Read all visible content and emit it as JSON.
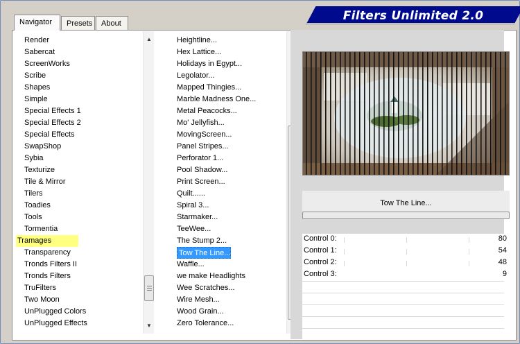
{
  "tabs": [
    {
      "label": "Navigator",
      "active": true
    },
    {
      "label": "Presets",
      "active": false
    },
    {
      "label": "About",
      "active": false
    }
  ],
  "banner": {
    "title": "Filters Unlimited 2.0",
    "color": "#000a8c"
  },
  "categories": {
    "items": [
      "Render",
      "Sabercat",
      "ScreenWorks",
      "Scribe",
      "Shapes",
      "Simple",
      "Special Effects 1",
      "Special Effects 2",
      "Special Effects",
      "SwapShop",
      "Sybia",
      "Texturize",
      "Tile & Mirror",
      "Tilers",
      "Toadies",
      "Tools",
      "Tormentia",
      "Tramages",
      "Transparency",
      "Tronds Filters II",
      "Tronds Filters",
      "TruFilters",
      "Two Moon",
      "UnPlugged Colors",
      "UnPlugged Effects"
    ],
    "marked_item": "Tramages"
  },
  "filters": {
    "items": [
      "Heightline...",
      "Hex Lattice...",
      "Holidays in Egypt...",
      "Legolator...",
      "Mapped Thingies...",
      "Marble Madness One...",
      "Metal Peacocks...",
      "Mo' Jellyfish...",
      "MovingScreen...",
      "Panel Stripes...",
      "Perforator 1...",
      "Pool Shadow...",
      "Print Screen...",
      "Quilt......",
      "Spiral 3...",
      "Starmaker...",
      "TeeWee...",
      "The Stump 2...",
      "Tow The Line...",
      "Waffle...",
      "we make Headlights",
      "Wee Scratches...",
      "Wire Mesh...",
      "Wood Grain...",
      "Zero Tolerance..."
    ],
    "selected_item": "Tow The Line..."
  },
  "icons": {
    "scroll_up": "scroll-up-arrow-icon",
    "scroll_down": "scroll-down-arrow-icon",
    "thumb_grip": "scroll-thumb-grip-icon"
  },
  "preview": {
    "label": "Tow The Line..."
  },
  "controls": [
    {
      "label": "Control 0:",
      "value": "80"
    },
    {
      "label": "Control 1:",
      "value": "54"
    },
    {
      "label": "Control 2:",
      "value": "48"
    },
    {
      "label": "Control 3:",
      "value": "9"
    }
  ],
  "colors": {
    "selection": "#3399ff",
    "marker": "#ffff80",
    "window_bg": "#d4d0c8"
  }
}
